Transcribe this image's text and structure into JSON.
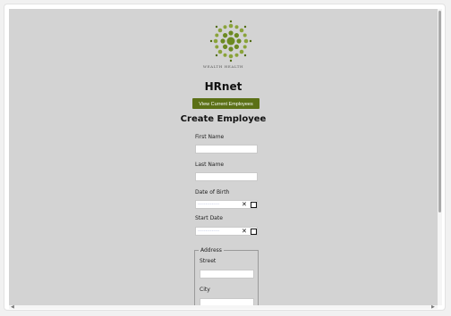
{
  "brand": {
    "name": "Wealth Health",
    "accent": "#5b7016"
  },
  "header": {
    "title": "HRnet"
  },
  "nav": {
    "view_employees_label": "View Current Employees"
  },
  "form": {
    "title": "Create Employee",
    "first_name_label": "First Name",
    "last_name_label": "Last Name",
    "dob_label": "Date of Birth",
    "start_date_label": "Start Date",
    "date_placeholder": "--------------",
    "date_clear_glyph": "✕",
    "address": {
      "legend": "Address",
      "street_label": "Street",
      "city_label": "City"
    }
  },
  "icons": [
    "logo-icon",
    "clear-icon",
    "calendar-icon",
    "scroll-arrow-left-icon",
    "scroll-arrow-right-icon"
  ]
}
